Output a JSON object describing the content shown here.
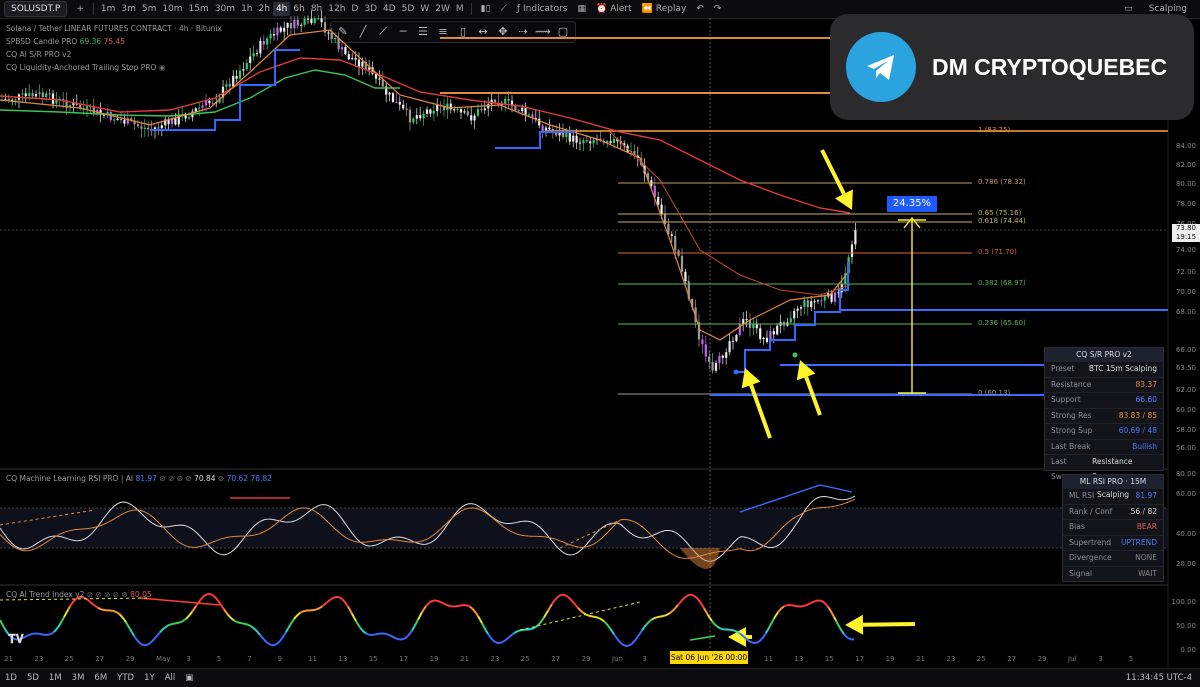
{
  "toolbar": {
    "symbol": "SOLUSDT.P",
    "timeframes": [
      "1m",
      "3m",
      "5m",
      "10m",
      "15m",
      "30m",
      "1h",
      "2h",
      "4h",
      "6h",
      "8h",
      "12h",
      "D",
      "3D",
      "4D",
      "5D",
      "W",
      "2W",
      "M"
    ],
    "active_timeframe": "4h",
    "indicators_label": "Indicators",
    "alert_label": "Alert",
    "replay_label": "Replay",
    "account_label": "Scalping"
  },
  "legend": {
    "title": "Solana / Tether LINEAR FUTURES CONTRACT · 4h · Bitunix",
    "line2": "SPBSD Candle PRO",
    "line2_v1": "69.36",
    "line2_v2": "75.45",
    "line3": "CQ AI S/R PRO v2",
    "line4": "CQ Liquidity-Anchored Trailing Stop PRO"
  },
  "banner": {
    "text": "DM CRYPTOQUEBEC"
  },
  "fib_levels": [
    {
      "label": "1 (83.25)",
      "color": "#e08a3c"
    },
    {
      "label": "0.786 (78.32)",
      "color": "#c79a6a"
    },
    {
      "label": "0.65 (75.16)",
      "color": "#c7b26a"
    },
    {
      "label": "0.618 (74.44)",
      "color": "#c7b26a"
    },
    {
      "label": "0.5 (71.70)",
      "color": "#e0663c"
    },
    {
      "label": "0.382 (68.97)",
      "color": "#5ab85a"
    },
    {
      "label": "0.236 (65.60)",
      "color": "#5ab85a"
    },
    {
      "label": "0 (60.13)",
      "color": "#9a9a9a"
    }
  ],
  "pct_label": "24.35%",
  "current_price": {
    "price": "73.80",
    "time": "19:15"
  },
  "price_axis": [
    "84.00",
    "82.00",
    "80.00",
    "78.00",
    "76.00",
    "74.00",
    "72.00",
    "70.00",
    "68.00",
    "66.00",
    "63.50",
    "62.00",
    "60.00",
    "58.00",
    "56.00"
  ],
  "sr_panel": {
    "title": "CQ S/R PRO v2",
    "rows": [
      {
        "k": "Preset",
        "v": "BTC 15m Scalping",
        "c": "#ddd"
      },
      {
        "k": "Resistance",
        "v": "83.37",
        "c": "#e08a3c"
      },
      {
        "k": "Support",
        "v": "66.60",
        "c": "#4a7bff"
      },
      {
        "k": "Strong Res",
        "v": "83.83 / 85",
        "c": "#e08a3c"
      },
      {
        "k": "Strong Sup",
        "v": "60.69 / 48",
        "c": "#4a7bff"
      },
      {
        "k": "Last Break",
        "v": "Bullish",
        "c": "#4a7bff"
      },
      {
        "k": "Last Sweep",
        "v": "Resistance Sweep",
        "c": "#ddd"
      }
    ]
  },
  "rsi": {
    "title": "CQ Machine Learning RSI PRO | AI",
    "vals": [
      "81.97",
      "70.84",
      "70.62",
      "78.82"
    ],
    "axis": [
      "80.00",
      "60.00",
      "40.00",
      "20.00"
    ]
  },
  "rsi_panel": {
    "title": "ML RSI PRO · 15M Scalping",
    "rows": [
      {
        "k": "ML RSI",
        "v": "81.97",
        "c": "#4a7bff"
      },
      {
        "k": "Rank / Conf",
        "v": "56 / 82",
        "c": "#ddd"
      },
      {
        "k": "Bias",
        "v": "BEAR",
        "c": "#e05a5a"
      },
      {
        "k": "Supertrend",
        "v": "UPTREND",
        "c": "#4a7bff"
      },
      {
        "k": "Divergence",
        "v": "NONE",
        "c": "#888"
      },
      {
        "k": "Signal",
        "v": "WAIT",
        "c": "#888"
      }
    ]
  },
  "trend": {
    "title": "CQ AI Trend Index v2",
    "val": "80.05",
    "axis": [
      "100.00",
      "50.00",
      "0.00"
    ]
  },
  "time_axis": [
    "21",
    "23",
    "25",
    "27",
    "29",
    "May",
    "3",
    "5",
    "7",
    "9",
    "11",
    "13",
    "15",
    "17",
    "19",
    "21",
    "23",
    "25",
    "27",
    "29",
    "Jun",
    "3",
    "5",
    "7",
    "9",
    "11",
    "13",
    "15",
    "17",
    "19",
    "21",
    "23",
    "25",
    "27",
    "29",
    "Jul",
    "3",
    "5"
  ],
  "cursor_label": "Sat 06 Jun '26   00:00",
  "bottom": {
    "ranges": [
      "1D",
      "5D",
      "1M",
      "3M",
      "6M",
      "YTD",
      "1Y",
      "All"
    ],
    "clock": "11:34:45 UTC-4"
  }
}
